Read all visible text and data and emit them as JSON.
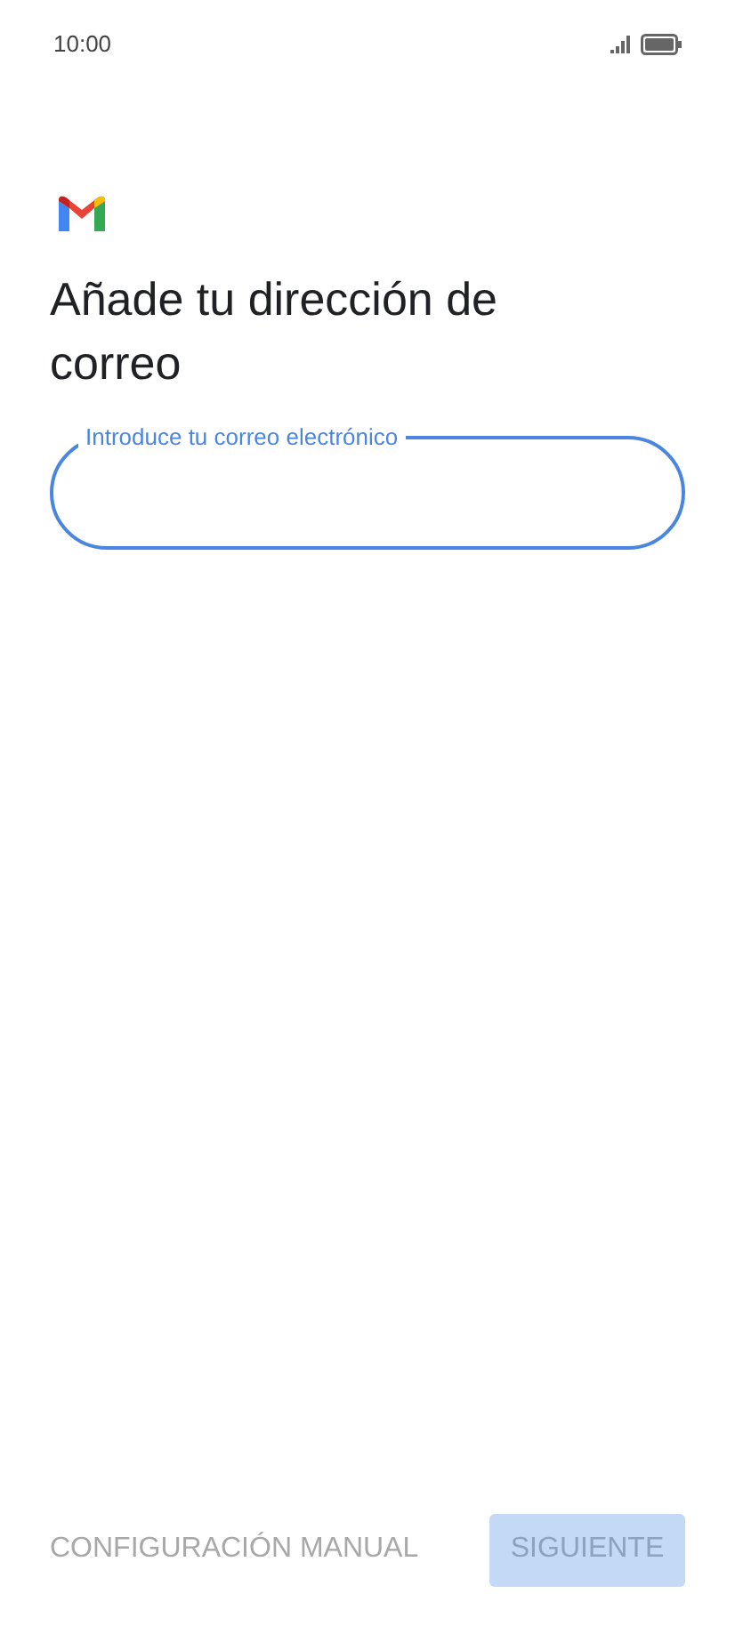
{
  "status_bar": {
    "time": "10:00"
  },
  "title": "Añade tu dirección de correo",
  "email_field": {
    "label": "Introduce tu correo electrónico",
    "focused": true
  },
  "buttons": [
    {
      "label": "CONFIGURACIÓN MANUAL",
      "kind": "text",
      "disabled": true
    },
    {
      "label": "SIGUIENTE",
      "kind": "filled",
      "disabled": true
    }
  ]
}
